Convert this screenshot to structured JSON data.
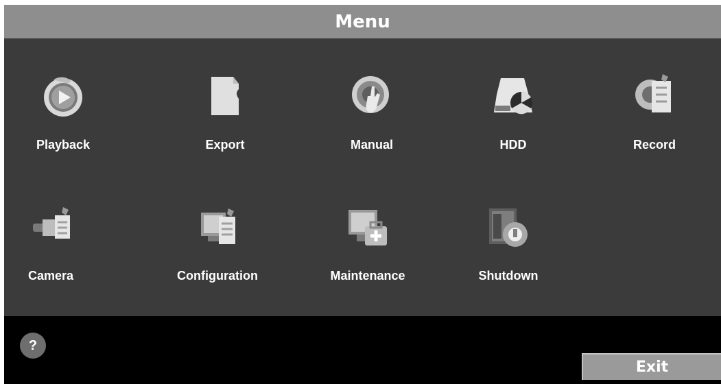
{
  "header": {
    "title": "Menu"
  },
  "menu": {
    "row1": [
      {
        "label": "Playback",
        "icon": "playback-icon"
      },
      {
        "label": "Export",
        "icon": "export-icon"
      },
      {
        "label": "Manual",
        "icon": "manual-icon"
      },
      {
        "label": "HDD",
        "icon": "hdd-icon"
      },
      {
        "label": "Record",
        "icon": "record-icon"
      }
    ],
    "row2": [
      {
        "label": "Camera",
        "icon": "camera-icon"
      },
      {
        "label": "Configuration",
        "icon": "configuration-icon"
      },
      {
        "label": "Maintenance",
        "icon": "maintenance-icon"
      },
      {
        "label": "Shutdown",
        "icon": "shutdown-icon"
      }
    ]
  },
  "footer": {
    "help_label": "?",
    "exit_label": "Exit"
  },
  "colors": {
    "title_bar": "#8e8e8e",
    "panel": "#3b3b3b",
    "footer": "#000000",
    "button": "#9a9a9a"
  }
}
